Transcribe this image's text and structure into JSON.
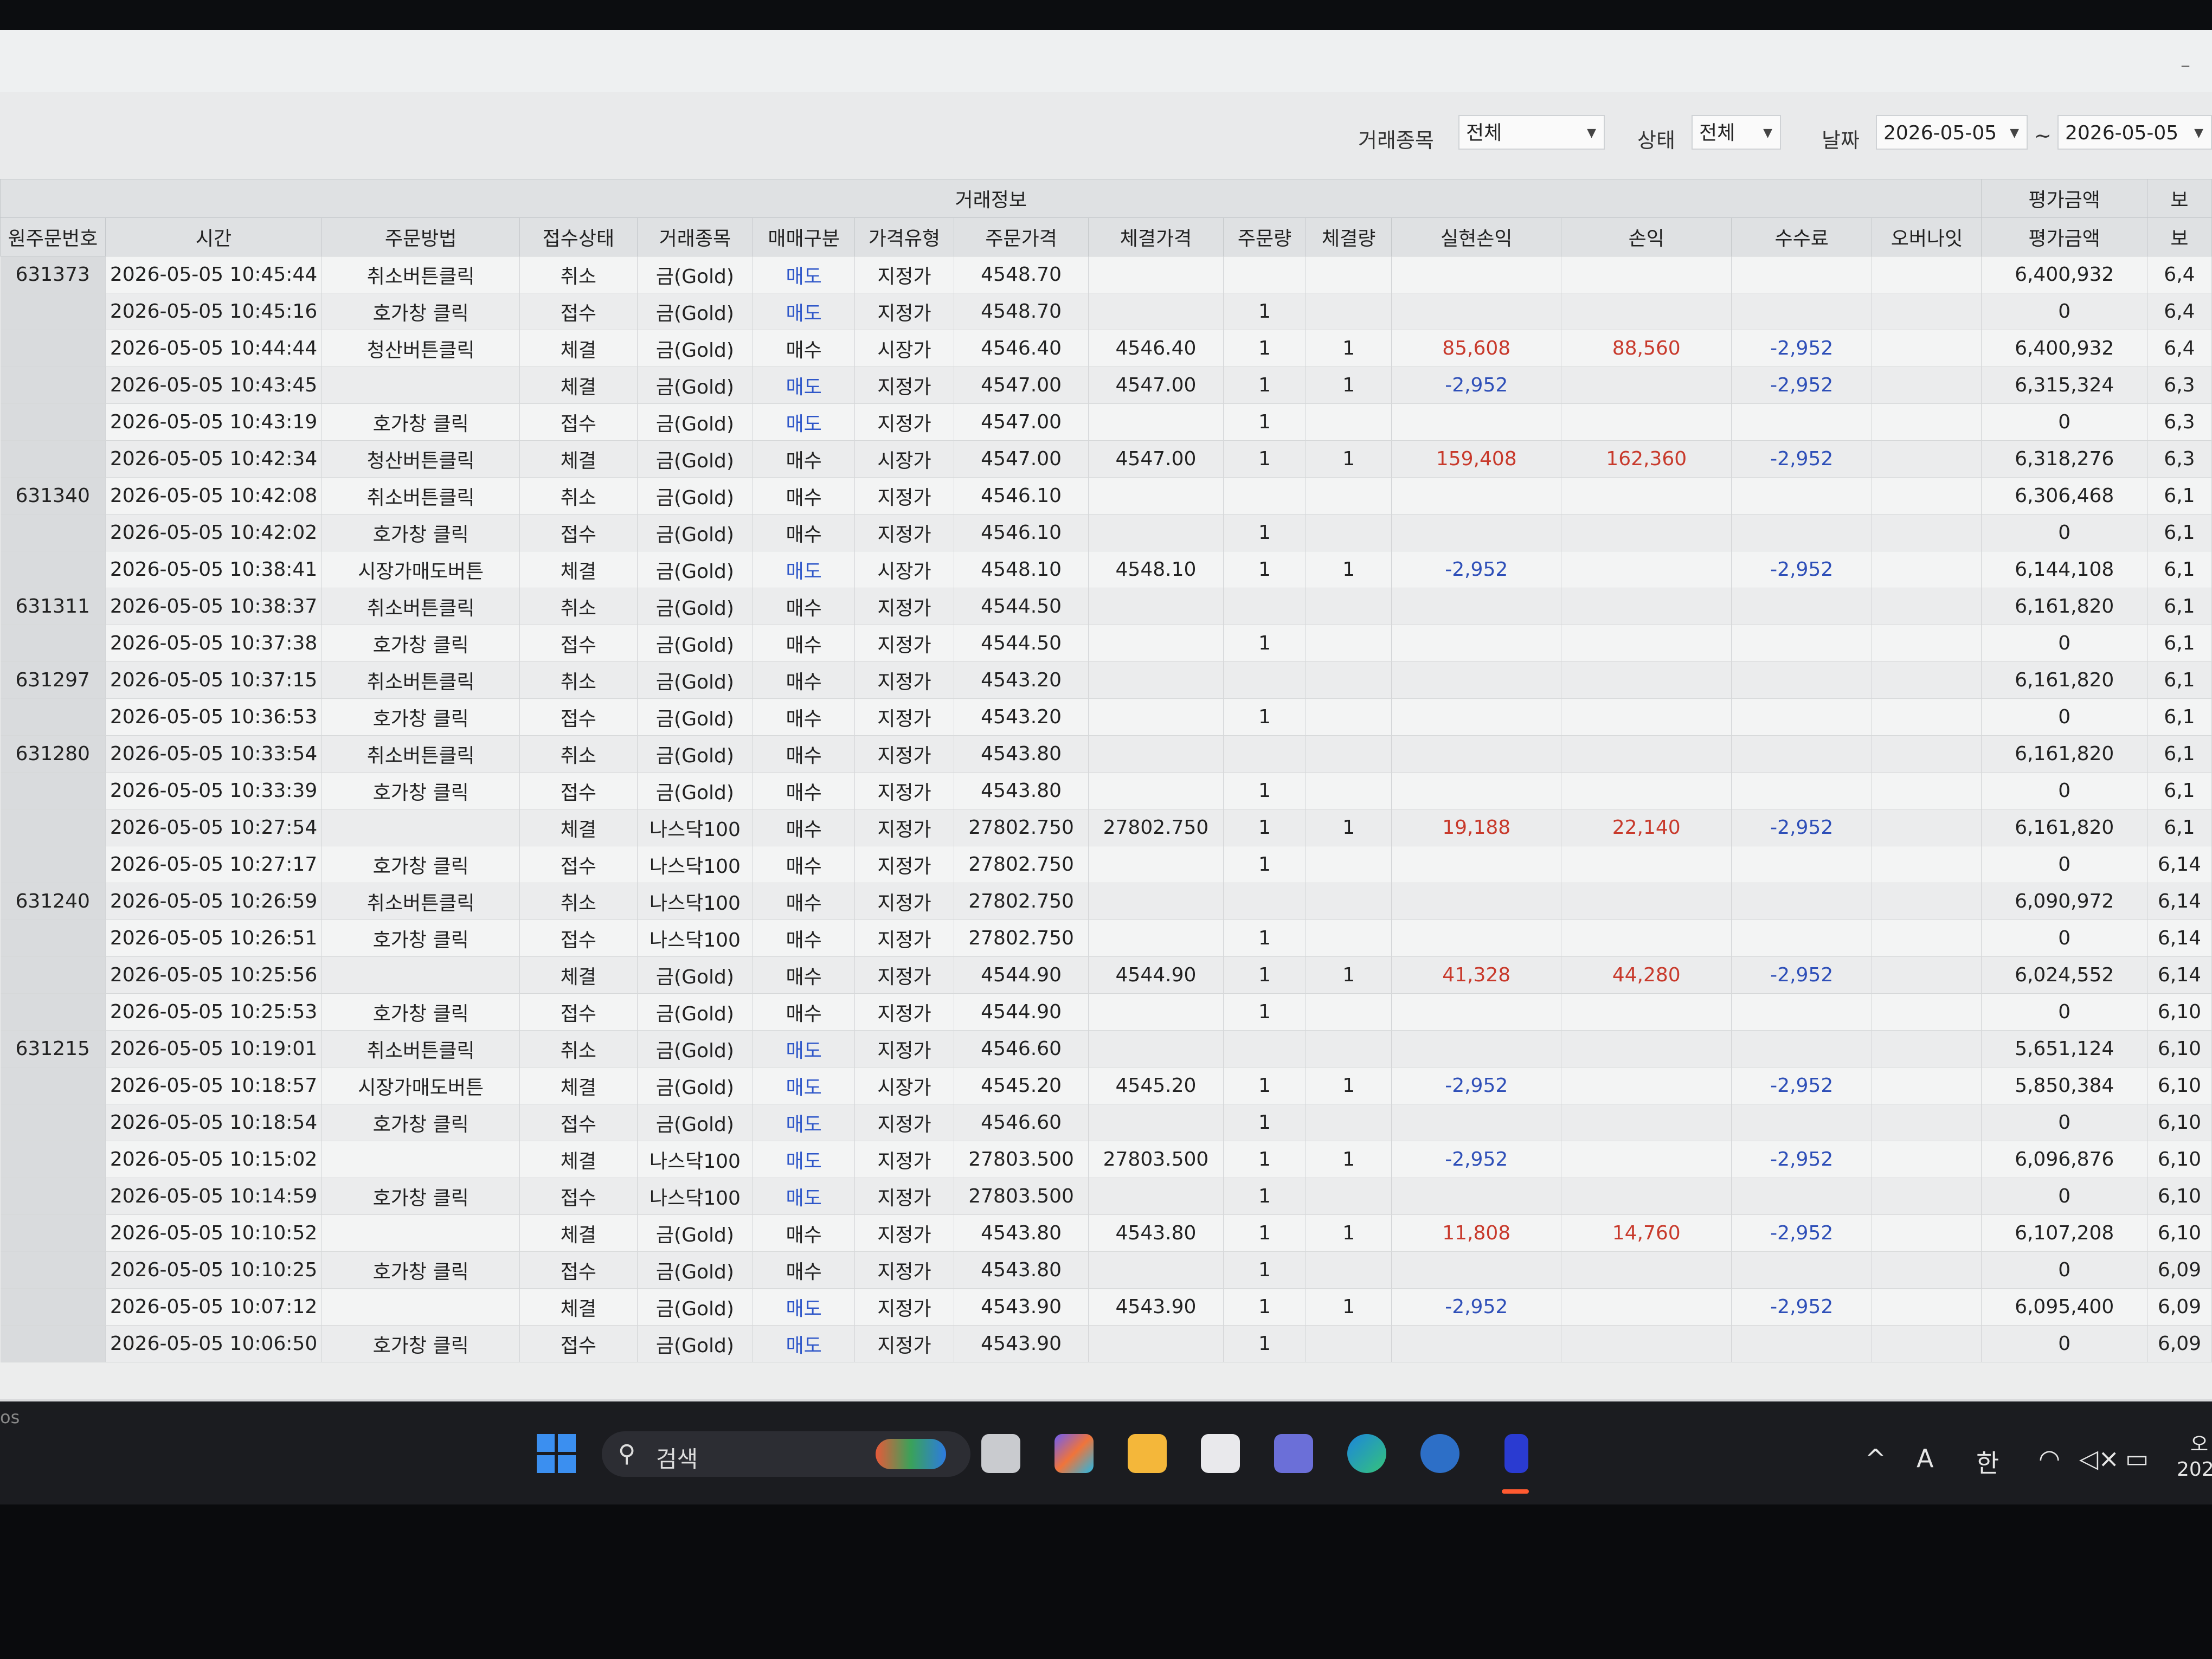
{
  "filters": {
    "instrument_label": "거래종목",
    "instrument_value": "전체",
    "status_label": "상태",
    "status_value": "전체",
    "date_label": "날짜",
    "date_from": "2026-05-05",
    "date_separator": "~",
    "date_to": "2026-05-05"
  },
  "grid": {
    "group_header": "거래정보",
    "valuation_group": "평가금액",
    "columns": [
      "원주문번호",
      "시간",
      "주문방법",
      "접수상태",
      "거래종목",
      "매매구분",
      "가격유형",
      "주문가격",
      "체결가격",
      "주문량",
      "체결량",
      "실현손익",
      "손익",
      "수수료",
      "오버나잇",
      "평가금액",
      "보"
    ],
    "rows": [
      {
        "orig": "631373",
        "time": "2026-05-05 10:45:44",
        "method": "취소버튼클릭",
        "status": "취소",
        "item": "금(Gold)",
        "side": "매도",
        "ptype": "지정가",
        "oprice": "4548.70",
        "fprice": "",
        "oqty": "",
        "fqty": "",
        "realized": "",
        "pnl": "",
        "fee": "",
        "overnight": "",
        "val": "6,400,932",
        "extra": "6,4"
      },
      {
        "orig": "",
        "time": "2026-05-05 10:45:16",
        "method": "호가창 클릭",
        "status": "접수",
        "item": "금(Gold)",
        "side": "매도",
        "ptype": "지정가",
        "oprice": "4548.70",
        "fprice": "",
        "oqty": "1",
        "fqty": "",
        "realized": "",
        "pnl": "",
        "fee": "",
        "overnight": "",
        "val": "0",
        "extra": "6,4"
      },
      {
        "orig": "",
        "time": "2026-05-05 10:44:44",
        "method": "청산버튼클릭",
        "status": "체결",
        "item": "금(Gold)",
        "side": "매수",
        "ptype": "시장가",
        "oprice": "4546.40",
        "fprice": "4546.40",
        "oqty": "1",
        "fqty": "1",
        "realized": "85,608",
        "pnl": "88,560",
        "fee": "-2,952",
        "overnight": "",
        "val": "6,400,932",
        "extra": "6,4"
      },
      {
        "orig": "",
        "time": "2026-05-05 10:43:45",
        "method": "",
        "status": "체결",
        "item": "금(Gold)",
        "side": "매도",
        "ptype": "지정가",
        "oprice": "4547.00",
        "fprice": "4547.00",
        "oqty": "1",
        "fqty": "1",
        "realized": "-2,952",
        "pnl": "",
        "fee": "-2,952",
        "overnight": "",
        "val": "6,315,324",
        "extra": "6,3"
      },
      {
        "orig": "",
        "time": "2026-05-05 10:43:19",
        "method": "호가창 클릭",
        "status": "접수",
        "item": "금(Gold)",
        "side": "매도",
        "ptype": "지정가",
        "oprice": "4547.00",
        "fprice": "",
        "oqty": "1",
        "fqty": "",
        "realized": "",
        "pnl": "",
        "fee": "",
        "overnight": "",
        "val": "0",
        "extra": "6,3"
      },
      {
        "orig": "",
        "time": "2026-05-05 10:42:34",
        "method": "청산버튼클릭",
        "status": "체결",
        "item": "금(Gold)",
        "side": "매수",
        "ptype": "시장가",
        "oprice": "4547.00",
        "fprice": "4547.00",
        "oqty": "1",
        "fqty": "1",
        "realized": "159,408",
        "pnl": "162,360",
        "fee": "-2,952",
        "overnight": "",
        "val": "6,318,276",
        "extra": "6,3"
      },
      {
        "orig": "631340",
        "time": "2026-05-05 10:42:08",
        "method": "취소버튼클릭",
        "status": "취소",
        "item": "금(Gold)",
        "side": "매수",
        "ptype": "지정가",
        "oprice": "4546.10",
        "fprice": "",
        "oqty": "",
        "fqty": "",
        "realized": "",
        "pnl": "",
        "fee": "",
        "overnight": "",
        "val": "6,306,468",
        "extra": "6,1"
      },
      {
        "orig": "",
        "time": "2026-05-05 10:42:02",
        "method": "호가창 클릭",
        "status": "접수",
        "item": "금(Gold)",
        "side": "매수",
        "ptype": "지정가",
        "oprice": "4546.10",
        "fprice": "",
        "oqty": "1",
        "fqty": "",
        "realized": "",
        "pnl": "",
        "fee": "",
        "overnight": "",
        "val": "0",
        "extra": "6,1"
      },
      {
        "orig": "",
        "time": "2026-05-05 10:38:41",
        "method": "시장가매도버튼",
        "status": "체결",
        "item": "금(Gold)",
        "side": "매도",
        "ptype": "시장가",
        "oprice": "4548.10",
        "fprice": "4548.10",
        "oqty": "1",
        "fqty": "1",
        "realized": "-2,952",
        "pnl": "",
        "fee": "-2,952",
        "overnight": "",
        "val": "6,144,108",
        "extra": "6,1"
      },
      {
        "orig": "631311",
        "time": "2026-05-05 10:38:37",
        "method": "취소버튼클릭",
        "status": "취소",
        "item": "금(Gold)",
        "side": "매수",
        "ptype": "지정가",
        "oprice": "4544.50",
        "fprice": "",
        "oqty": "",
        "fqty": "",
        "realized": "",
        "pnl": "",
        "fee": "",
        "overnight": "",
        "val": "6,161,820",
        "extra": "6,1"
      },
      {
        "orig": "",
        "time": "2026-05-05 10:37:38",
        "method": "호가창 클릭",
        "status": "접수",
        "item": "금(Gold)",
        "side": "매수",
        "ptype": "지정가",
        "oprice": "4544.50",
        "fprice": "",
        "oqty": "1",
        "fqty": "",
        "realized": "",
        "pnl": "",
        "fee": "",
        "overnight": "",
        "val": "0",
        "extra": "6,1"
      },
      {
        "orig": "631297",
        "time": "2026-05-05 10:37:15",
        "method": "취소버튼클릭",
        "status": "취소",
        "item": "금(Gold)",
        "side": "매수",
        "ptype": "지정가",
        "oprice": "4543.20",
        "fprice": "",
        "oqty": "",
        "fqty": "",
        "realized": "",
        "pnl": "",
        "fee": "",
        "overnight": "",
        "val": "6,161,820",
        "extra": "6,1"
      },
      {
        "orig": "",
        "time": "2026-05-05 10:36:53",
        "method": "호가창 클릭",
        "status": "접수",
        "item": "금(Gold)",
        "side": "매수",
        "ptype": "지정가",
        "oprice": "4543.20",
        "fprice": "",
        "oqty": "1",
        "fqty": "",
        "realized": "",
        "pnl": "",
        "fee": "",
        "overnight": "",
        "val": "0",
        "extra": "6,1"
      },
      {
        "orig": "631280",
        "time": "2026-05-05 10:33:54",
        "method": "취소버튼클릭",
        "status": "취소",
        "item": "금(Gold)",
        "side": "매수",
        "ptype": "지정가",
        "oprice": "4543.80",
        "fprice": "",
        "oqty": "",
        "fqty": "",
        "realized": "",
        "pnl": "",
        "fee": "",
        "overnight": "",
        "val": "6,161,820",
        "extra": "6,1"
      },
      {
        "orig": "",
        "time": "2026-05-05 10:33:39",
        "method": "호가창 클릭",
        "status": "접수",
        "item": "금(Gold)",
        "side": "매수",
        "ptype": "지정가",
        "oprice": "4543.80",
        "fprice": "",
        "oqty": "1",
        "fqty": "",
        "realized": "",
        "pnl": "",
        "fee": "",
        "overnight": "",
        "val": "0",
        "extra": "6,1"
      },
      {
        "orig": "",
        "time": "2026-05-05 10:27:54",
        "method": "",
        "status": "체결",
        "item": "나스닥100",
        "side": "매수",
        "ptype": "지정가",
        "oprice": "27802.750",
        "fprice": "27802.750",
        "oqty": "1",
        "fqty": "1",
        "realized": "19,188",
        "pnl": "22,140",
        "fee": "-2,952",
        "overnight": "",
        "val": "6,161,820",
        "extra": "6,1"
      },
      {
        "orig": "",
        "time": "2026-05-05 10:27:17",
        "method": "호가창 클릭",
        "status": "접수",
        "item": "나스닥100",
        "side": "매수",
        "ptype": "지정가",
        "oprice": "27802.750",
        "fprice": "",
        "oqty": "1",
        "fqty": "",
        "realized": "",
        "pnl": "",
        "fee": "",
        "overnight": "",
        "val": "0",
        "extra": "6,14"
      },
      {
        "orig": "631240",
        "time": "2026-05-05 10:26:59",
        "method": "취소버튼클릭",
        "status": "취소",
        "item": "나스닥100",
        "side": "매수",
        "ptype": "지정가",
        "oprice": "27802.750",
        "fprice": "",
        "oqty": "",
        "fqty": "",
        "realized": "",
        "pnl": "",
        "fee": "",
        "overnight": "",
        "val": "6,090,972",
        "extra": "6,14"
      },
      {
        "orig": "",
        "time": "2026-05-05 10:26:51",
        "method": "호가창 클릭",
        "status": "접수",
        "item": "나스닥100",
        "side": "매수",
        "ptype": "지정가",
        "oprice": "27802.750",
        "fprice": "",
        "oqty": "1",
        "fqty": "",
        "realized": "",
        "pnl": "",
        "fee": "",
        "overnight": "",
        "val": "0",
        "extra": "6,14"
      },
      {
        "orig": "",
        "time": "2026-05-05 10:25:56",
        "method": "",
        "status": "체결",
        "item": "금(Gold)",
        "side": "매수",
        "ptype": "지정가",
        "oprice": "4544.90",
        "fprice": "4544.90",
        "oqty": "1",
        "fqty": "1",
        "realized": "41,328",
        "pnl": "44,280",
        "fee": "-2,952",
        "overnight": "",
        "val": "6,024,552",
        "extra": "6,14"
      },
      {
        "orig": "",
        "time": "2026-05-05 10:25:53",
        "method": "호가창 클릭",
        "status": "접수",
        "item": "금(Gold)",
        "side": "매수",
        "ptype": "지정가",
        "oprice": "4544.90",
        "fprice": "",
        "oqty": "1",
        "fqty": "",
        "realized": "",
        "pnl": "",
        "fee": "",
        "overnight": "",
        "val": "0",
        "extra": "6,10"
      },
      {
        "orig": "631215",
        "time": "2026-05-05 10:19:01",
        "method": "취소버튼클릭",
        "status": "취소",
        "item": "금(Gold)",
        "side": "매도",
        "ptype": "지정가",
        "oprice": "4546.60",
        "fprice": "",
        "oqty": "",
        "fqty": "",
        "realized": "",
        "pnl": "",
        "fee": "",
        "overnight": "",
        "val": "5,651,124",
        "extra": "6,10"
      },
      {
        "orig": "",
        "time": "2026-05-05 10:18:57",
        "method": "시장가매도버튼",
        "status": "체결",
        "item": "금(Gold)",
        "side": "매도",
        "ptype": "시장가",
        "oprice": "4545.20",
        "fprice": "4545.20",
        "oqty": "1",
        "fqty": "1",
        "realized": "-2,952",
        "pnl": "",
        "fee": "-2,952",
        "overnight": "",
        "val": "5,850,384",
        "extra": "6,10"
      },
      {
        "orig": "",
        "time": "2026-05-05 10:18:54",
        "method": "호가창 클릭",
        "status": "접수",
        "item": "금(Gold)",
        "side": "매도",
        "ptype": "지정가",
        "oprice": "4546.60",
        "fprice": "",
        "oqty": "1",
        "fqty": "",
        "realized": "",
        "pnl": "",
        "fee": "",
        "overnight": "",
        "val": "0",
        "extra": "6,10"
      },
      {
        "orig": "",
        "time": "2026-05-05 10:15:02",
        "method": "",
        "status": "체결",
        "item": "나스닥100",
        "side": "매도",
        "ptype": "지정가",
        "oprice": "27803.500",
        "fprice": "27803.500",
        "oqty": "1",
        "fqty": "1",
        "realized": "-2,952",
        "pnl": "",
        "fee": "-2,952",
        "overnight": "",
        "val": "6,096,876",
        "extra": "6,10"
      },
      {
        "orig": "",
        "time": "2026-05-05 10:14:59",
        "method": "호가창 클릭",
        "status": "접수",
        "item": "나스닥100",
        "side": "매도",
        "ptype": "지정가",
        "oprice": "27803.500",
        "fprice": "",
        "oqty": "1",
        "fqty": "",
        "realized": "",
        "pnl": "",
        "fee": "",
        "overnight": "",
        "val": "0",
        "extra": "6,10"
      },
      {
        "orig": "",
        "time": "2026-05-05 10:10:52",
        "method": "",
        "status": "체결",
        "item": "금(Gold)",
        "side": "매수",
        "ptype": "지정가",
        "oprice": "4543.80",
        "fprice": "4543.80",
        "oqty": "1",
        "fqty": "1",
        "realized": "11,808",
        "pnl": "14,760",
        "fee": "-2,952",
        "overnight": "",
        "val": "6,107,208",
        "extra": "6,10"
      },
      {
        "orig": "",
        "time": "2026-05-05 10:10:25",
        "method": "호가창 클릭",
        "status": "접수",
        "item": "금(Gold)",
        "side": "매수",
        "ptype": "지정가",
        "oprice": "4543.80",
        "fprice": "",
        "oqty": "1",
        "fqty": "",
        "realized": "",
        "pnl": "",
        "fee": "",
        "overnight": "",
        "val": "0",
        "extra": "6,09"
      },
      {
        "orig": "",
        "time": "2026-05-05 10:07:12",
        "method": "",
        "status": "체결",
        "item": "금(Gold)",
        "side": "매도",
        "ptype": "지정가",
        "oprice": "4543.90",
        "fprice": "4543.90",
        "oqty": "1",
        "fqty": "1",
        "realized": "-2,952",
        "pnl": "",
        "fee": "-2,952",
        "overnight": "",
        "val": "6,095,400",
        "extra": "6,09"
      },
      {
        "orig": "",
        "time": "2026-05-05 10:06:50",
        "method": "호가창 클릭",
        "status": "접수",
        "item": "금(Gold)",
        "side": "매도",
        "ptype": "지정가",
        "oprice": "4543.90",
        "fprice": "",
        "oqty": "1",
        "fqty": "",
        "realized": "",
        "pnl": "",
        "fee": "",
        "overnight": "",
        "val": "0",
        "extra": "6,09"
      }
    ]
  },
  "taskbar": {
    "os_label": "os",
    "search_placeholder": "검색",
    "tray_ime": "A",
    "tray_lang": "한",
    "clock_partial": "오",
    "date_partial": "202"
  },
  "colors": {
    "sell_text": "#2f57c9",
    "profit_text": "#c83a2c",
    "loss_text": "#2e4fb8"
  }
}
